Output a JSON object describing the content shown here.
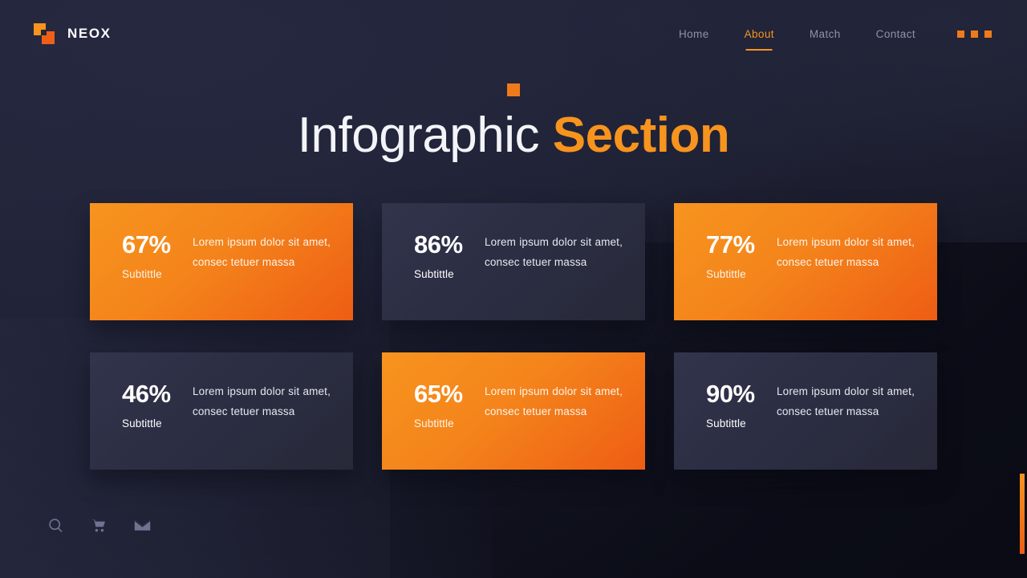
{
  "brand": {
    "name": "NEOX",
    "logo_icon": "two-squares-logo-icon"
  },
  "nav": {
    "items": [
      {
        "label": "Home",
        "active": false
      },
      {
        "label": "About",
        "active": true
      },
      {
        "label": "Match",
        "active": false
      },
      {
        "label": "Contact",
        "active": false
      }
    ],
    "menu_dots_icon": "three-squares-menu-icon"
  },
  "hero": {
    "accent_square_icon": "orange-square-accent",
    "title_light": "Infographic",
    "title_bold": "Section"
  },
  "cards": [
    {
      "percent": "67%",
      "subtitle": "Subtittle",
      "body": "Lorem ipsum dolor sit amet, consec tetuer massa",
      "style": "orange"
    },
    {
      "percent": "86%",
      "subtitle": "Subtittle",
      "body": "Lorem ipsum dolor sit amet, consec tetuer massa",
      "style": "dark"
    },
    {
      "percent": "77%",
      "subtitle": "Subtittle",
      "body": "Lorem ipsum dolor sit amet, consec tetuer massa",
      "style": "orange"
    },
    {
      "percent": "46%",
      "subtitle": "Subtittle",
      "body": "Lorem ipsum dolor sit amet, consec tetuer massa",
      "style": "dark"
    },
    {
      "percent": "65%",
      "subtitle": "Subtittle",
      "body": "Lorem ipsum dolor sit amet, consec tetuer massa",
      "style": "orange"
    },
    {
      "percent": "90%",
      "subtitle": "Subtittle",
      "body": "Lorem ipsum dolor sit amet, consec tetuer massa",
      "style": "dark"
    }
  ],
  "footer": {
    "icons": [
      "search-icon",
      "cart-icon",
      "mail-icon"
    ]
  },
  "colors": {
    "accent_orange": "#f7941e",
    "accent_orange_deep": "#ee5d14",
    "background_navy": "#23253a",
    "card_dark": "#2c2e44",
    "nav_inactive": "#8f93a8"
  },
  "chart_data": {
    "type": "bar",
    "title": "Infographic Section",
    "categories": [
      "Subtittle",
      "Subtittle",
      "Subtittle",
      "Subtittle",
      "Subtittle",
      "Subtittle"
    ],
    "values": [
      67,
      86,
      77,
      46,
      65,
      90
    ],
    "unit": "%",
    "ylim": [
      0,
      100
    ],
    "xlabel": "",
    "ylabel": "",
    "grid": false,
    "legend": false
  }
}
